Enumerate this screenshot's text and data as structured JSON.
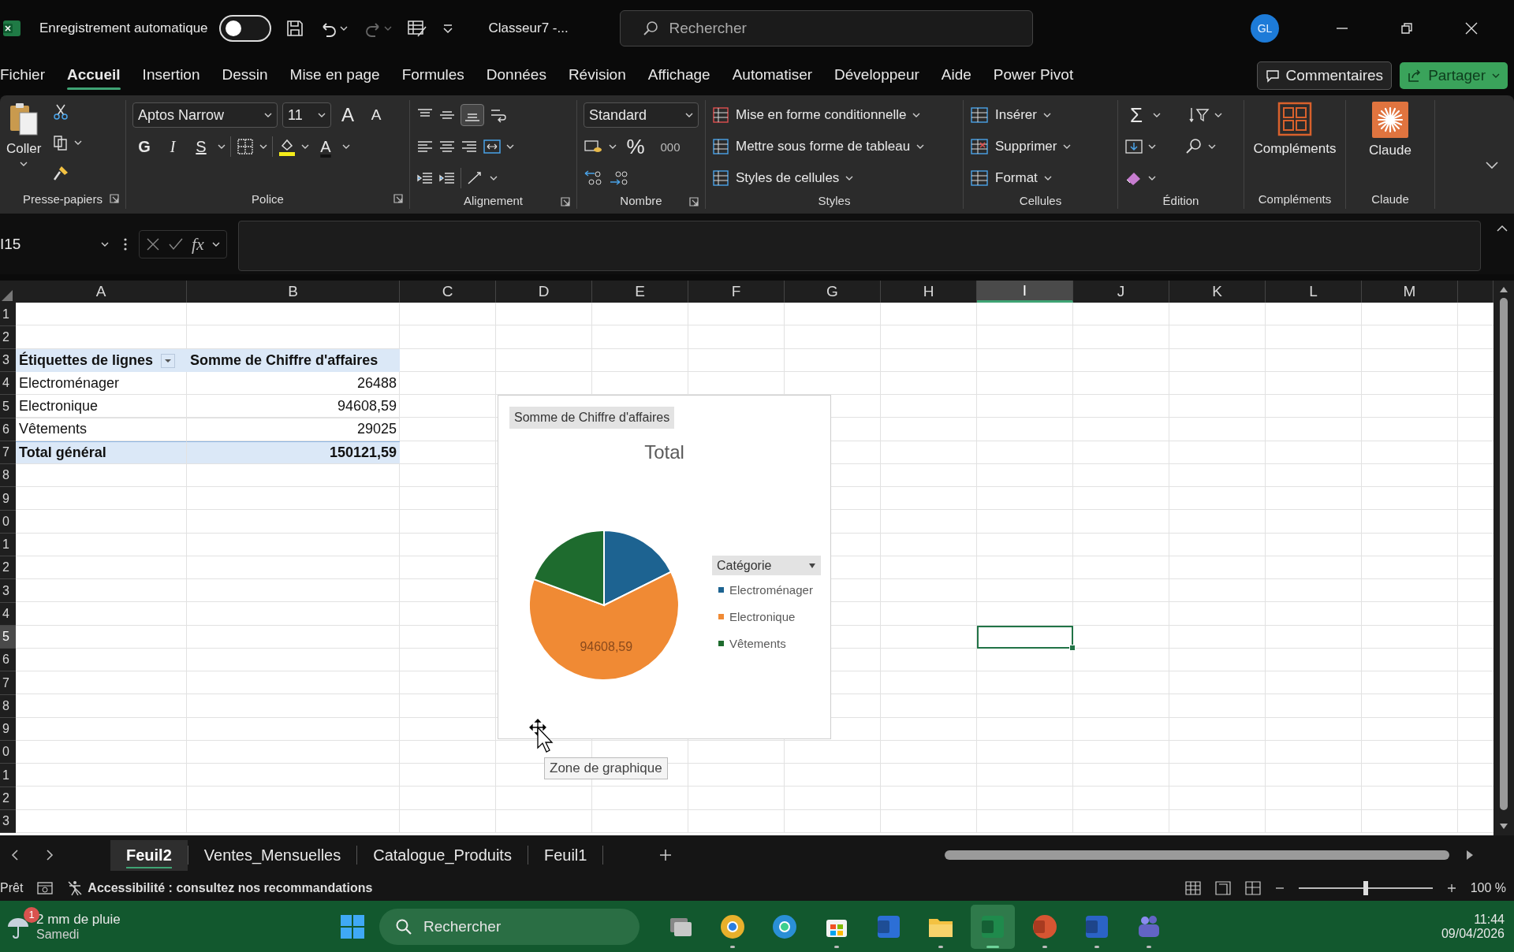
{
  "title_bar": {
    "autosave_label": "Enregistrement automatique",
    "autosave_on": false,
    "filename": "Classeur7  -...",
    "search_placeholder": "Rechercher",
    "avatar": "GL"
  },
  "menu_tabs": [
    {
      "label": "Fichier",
      "selected": false
    },
    {
      "label": "Accueil",
      "selected": true
    },
    {
      "label": "Insertion",
      "selected": false
    },
    {
      "label": "Dessin",
      "selected": false
    },
    {
      "label": "Mise en page",
      "selected": false
    },
    {
      "label": "Formules",
      "selected": false
    },
    {
      "label": "Données",
      "selected": false
    },
    {
      "label": "Révision",
      "selected": false
    },
    {
      "label": "Affichage",
      "selected": false
    },
    {
      "label": "Automatiser",
      "selected": false
    },
    {
      "label": "Développeur",
      "selected": false
    },
    {
      "label": "Aide",
      "selected": false
    },
    {
      "label": "Power Pivot",
      "selected": false
    }
  ],
  "comments_button": "Commentaires",
  "share_button": "Partager",
  "ribbon": {
    "clipboard": {
      "paste": "Coller",
      "group": "Presse-papiers"
    },
    "font": {
      "name": "Aptos Narrow",
      "size": "11",
      "grow": "A",
      "shrink": "A",
      "bold": "G",
      "italic": "I",
      "underline": "S",
      "color_glyph": "A",
      "group": "Police"
    },
    "alignment": {
      "group": "Alignement"
    },
    "number": {
      "format": "Standard",
      "percent": "%",
      "thousands": "000",
      "group": "Nombre"
    },
    "styles": {
      "items": [
        "Mise en forme conditionnelle",
        "Mettre sous forme de tableau",
        "Styles de cellules"
      ],
      "group": "Styles"
    },
    "cells": {
      "items": [
        "Insérer",
        "Supprimer",
        "Format"
      ],
      "group": "Cellules"
    },
    "editing": {
      "sum": "Σ",
      "group": "Édition"
    },
    "addins": {
      "label": "Compléments",
      "group": "Compléments"
    },
    "claude": {
      "label": "Claude",
      "group": "Claude"
    }
  },
  "formula_bar": {
    "name_box": "I15",
    "fx": "fx"
  },
  "sheet": {
    "columns": [
      {
        "label": "A",
        "selected": false
      },
      {
        "label": "B",
        "selected": false
      },
      {
        "label": "C",
        "selected": false
      },
      {
        "label": "D",
        "selected": false
      },
      {
        "label": "E",
        "selected": false
      },
      {
        "label": "F",
        "selected": false
      },
      {
        "label": "G",
        "selected": false
      },
      {
        "label": "H",
        "selected": false
      },
      {
        "label": "I",
        "selected": true
      },
      {
        "label": "J",
        "selected": false
      },
      {
        "label": "K",
        "selected": false
      },
      {
        "label": "L",
        "selected": false
      },
      {
        "label": "M",
        "selected": false
      }
    ],
    "rows": [
      {
        "label": "1",
        "selected": false
      },
      {
        "label": "2",
        "selected": false
      },
      {
        "label": "3",
        "selected": false
      },
      {
        "label": "4",
        "selected": false
      },
      {
        "label": "5",
        "selected": false
      },
      {
        "label": "6",
        "selected": false
      },
      {
        "label": "7",
        "selected": false
      },
      {
        "label": "8",
        "selected": false
      },
      {
        "label": "9",
        "selected": false
      },
      {
        "label": "0",
        "selected": false
      },
      {
        "label": "1",
        "selected": false
      },
      {
        "label": "2",
        "selected": false
      },
      {
        "label": "3",
        "selected": false
      },
      {
        "label": "4",
        "selected": false
      },
      {
        "label": "5",
        "selected": true
      },
      {
        "label": "6",
        "selected": false
      },
      {
        "label": "7",
        "selected": false
      },
      {
        "label": "8",
        "selected": false
      },
      {
        "label": "9",
        "selected": false
      },
      {
        "label": "0",
        "selected": false
      },
      {
        "label": "1",
        "selected": false
      },
      {
        "label": "2",
        "selected": false
      },
      {
        "label": "3",
        "selected": false
      }
    ],
    "pivot": {
      "headers": [
        "Étiquettes de lignes",
        "Somme de Chiffre d'affaires"
      ],
      "rows": [
        {
          "label": "Electroménager",
          "value": "26488"
        },
        {
          "label": "Electronique",
          "value": "94608,59"
        },
        {
          "label": "Vêtements",
          "value": "29025"
        }
      ],
      "total": {
        "label": "Total général",
        "value": "150121,59"
      }
    },
    "chart": {
      "field_button": "Somme de Chiffre d'affaires",
      "legend_field": "Catégorie",
      "data_label": "94608,59",
      "chart_data": {
        "type": "pie",
        "title": "Total",
        "categories": [
          "Electroménager",
          "Electronique",
          "Vêtements"
        ],
        "colors": [
          "#1d6391",
          "#f08a34",
          "#1e6b2e"
        ],
        "values": [
          17.64,
          63.02,
          19.34
        ],
        "legend": "right"
      }
    },
    "tooltip": "Zone de graphique"
  },
  "sheet_tabs": [
    {
      "label": "Feuil2",
      "selected": true
    },
    {
      "label": "Ventes_Mensuelles",
      "selected": false
    },
    {
      "label": "Catalogue_Produits",
      "selected": false
    },
    {
      "label": "Feuil1",
      "selected": false
    }
  ],
  "status_bar": {
    "ready": "Prêt",
    "accessibility": "Accessibilité : consultez nos recommandations",
    "zoom": "100 %",
    "level": 0.5
  },
  "taskbar": {
    "weather_badge": "1",
    "weather": "2 mm de pluie",
    "day": "Samedi",
    "search_placeholder": "Rechercher",
    "time": "11:44",
    "date": "09/04/2026",
    "apps": [
      {
        "kind": "task-view",
        "running": false,
        "active": false
      },
      {
        "kind": "chrome",
        "running": true,
        "active": false
      },
      {
        "kind": "edge",
        "running": false,
        "active": false
      },
      {
        "kind": "store",
        "running": true,
        "active": false
      },
      {
        "kind": "app",
        "running": false,
        "active": false
      },
      {
        "kind": "folder",
        "running": true,
        "active": false
      },
      {
        "kind": "excel",
        "running": true,
        "active": true
      },
      {
        "kind": "powerpoint",
        "running": true,
        "active": false
      },
      {
        "kind": "word",
        "running": true,
        "active": false
      },
      {
        "kind": "teams",
        "running": true,
        "active": false
      }
    ]
  }
}
